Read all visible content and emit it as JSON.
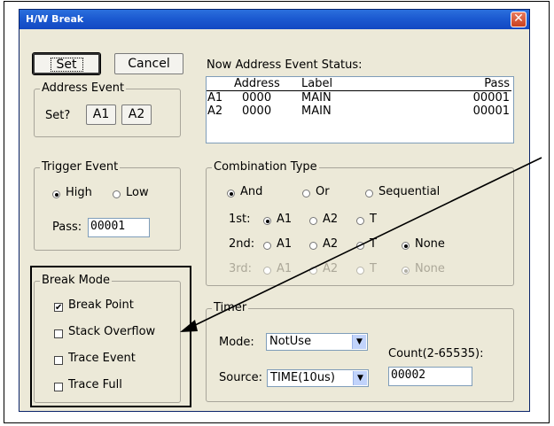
{
  "dialog": {
    "title": "H/W Break",
    "close": "✕"
  },
  "buttons": {
    "set": "Set",
    "cancel": "Cancel"
  },
  "address_event": {
    "label": "Address Event",
    "prompt": "Set?",
    "a1": "A1",
    "a2": "A2"
  },
  "status": {
    "label": "Now Address Event Status:",
    "headers": {
      "address": "Address",
      "label": "Label",
      "pass": "Pass"
    },
    "rows": [
      {
        "id": "A1",
        "address": "0000",
        "label": "MAIN",
        "pass": "00001"
      },
      {
        "id": "A2",
        "address": "0000",
        "label": "MAIN",
        "pass": "00001"
      }
    ]
  },
  "trigger": {
    "label": "Trigger Event",
    "high": "High",
    "low": "Low",
    "pass_label": "Pass:",
    "pass_value": "00001",
    "selected": "High"
  },
  "combination": {
    "label": "Combination Type",
    "types": {
      "and": "And",
      "or": "Or",
      "seq": "Sequential",
      "selected": "And"
    },
    "first": {
      "label": "1st:",
      "a1": "A1",
      "a2": "A2",
      "t": "T",
      "selected": "A1"
    },
    "second": {
      "label": "2nd:",
      "a1": "A1",
      "a2": "A2",
      "t": "T",
      "none": "None",
      "selected": "None"
    },
    "third": {
      "label": "3rd:",
      "a1": "A1",
      "a2": "A2",
      "t": "T",
      "none": "None",
      "selected": "None"
    }
  },
  "break_mode": {
    "label": "Break Mode",
    "items": [
      {
        "label": "Break Point",
        "checked": true
      },
      {
        "label": "Stack Overflow",
        "checked": false
      },
      {
        "label": "Trace Event",
        "checked": false
      },
      {
        "label": "Trace Full",
        "checked": false
      }
    ]
  },
  "timer": {
    "label": "Timer",
    "mode_label": "Mode:",
    "mode_value": "NotUse",
    "source_label": "Source:",
    "source_value": "TIME(10us)",
    "count_label": "Count(2-65535):",
    "count_value": "00002"
  },
  "icons": {
    "dropdown": "chevron-down-icon",
    "check": "✔"
  }
}
